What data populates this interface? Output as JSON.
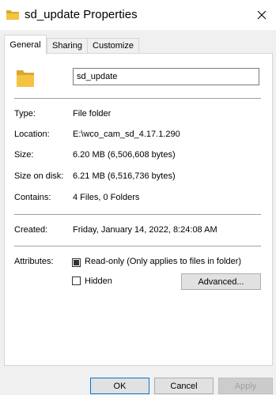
{
  "window": {
    "title": "sd_update Properties",
    "icon": "folder-icon"
  },
  "tabs": [
    {
      "label": "General",
      "active": true
    },
    {
      "label": "Sharing",
      "active": false
    },
    {
      "label": "Customize",
      "active": false
    }
  ],
  "general": {
    "name_value": "sd_update",
    "rows": {
      "type": {
        "label": "Type:",
        "value": "File folder"
      },
      "location": {
        "label": "Location:",
        "value": "E:\\wco_cam_sd_4.17.1.290"
      },
      "size": {
        "label": "Size:",
        "value": "6.20 MB (6,506,608 bytes)"
      },
      "size_on_disk": {
        "label": "Size on disk:",
        "value": "6.21 MB (6,516,736 bytes)"
      },
      "contains": {
        "label": "Contains:",
        "value": "4 Files, 0 Folders"
      },
      "created": {
        "label": "Created:",
        "value": "Friday, January 14, 2022, 8:24:08 AM"
      }
    },
    "attributes": {
      "label": "Attributes:",
      "readonly_label": "Read-only (Only applies to files in folder)",
      "readonly_state": "indeterminate",
      "hidden_label": "Hidden",
      "hidden_checked": false,
      "advanced_button": "Advanced..."
    }
  },
  "footer": {
    "ok": "OK",
    "cancel": "Cancel",
    "apply": "Apply"
  },
  "colors": {
    "folder": "#f5c342",
    "folder_dark": "#dba730",
    "accent": "#0078d7"
  }
}
